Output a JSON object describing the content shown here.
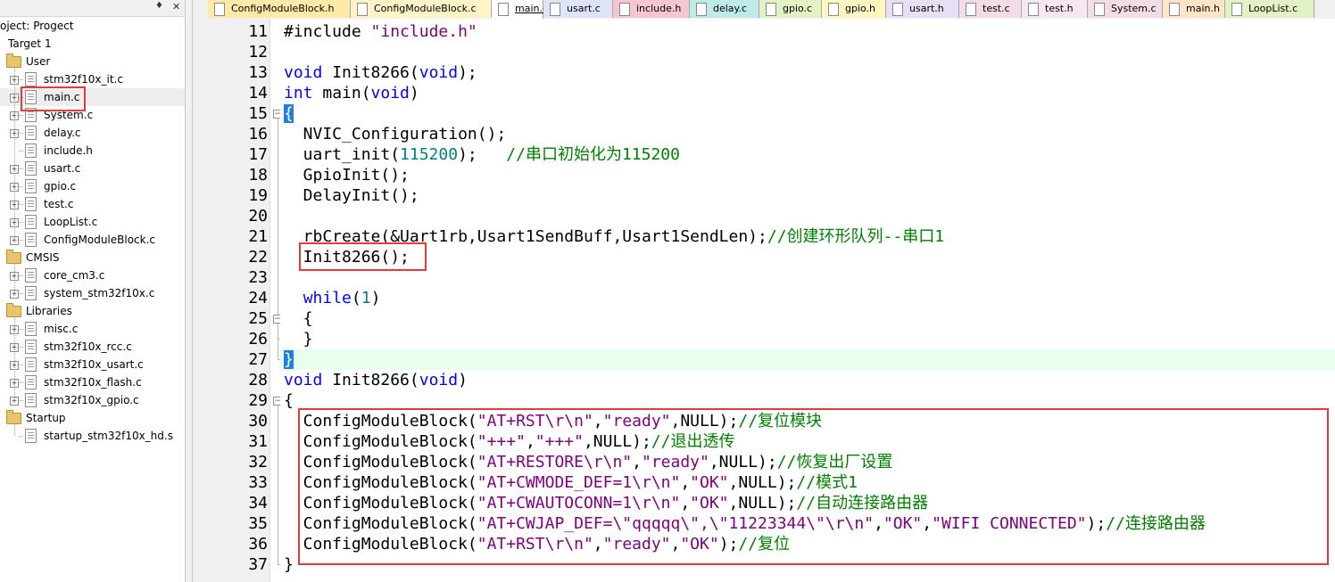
{
  "project_title": "oject: Progect",
  "tree": {
    "target": "Target 1",
    "groups": [
      {
        "name": "User",
        "files": [
          "stm32f10x_it.c",
          "main.c",
          "System.c",
          "delay.c",
          "include.h",
          "usart.c",
          "gpio.c",
          "test.c",
          "LoopList.c",
          "ConfigModuleBlock.c"
        ]
      },
      {
        "name": "CMSIS",
        "files": [
          "core_cm3.c",
          "system_stm32f10x.c"
        ]
      },
      {
        "name": "Libraries",
        "files": [
          "misc.c",
          "stm32f10x_rcc.c",
          "stm32f10x_usart.c",
          "stm32f10x_flash.c",
          "stm32f10x_gpio.c"
        ]
      },
      {
        "name": "Startup",
        "files": [
          "startup_stm32f10x_hd.s"
        ]
      }
    ]
  },
  "tabs": [
    {
      "label": "ConfigModuleBlock.h",
      "color": "#ffe9a8"
    },
    {
      "label": "ConfigModuleBlock.c",
      "color": "#fff3c8"
    },
    {
      "label": "main.c",
      "color": "#ffffff",
      "active": true
    },
    {
      "label": "usart.c",
      "color": "#dde4f5"
    },
    {
      "label": "include.h",
      "color": "#f5c6cf"
    },
    {
      "label": "delay.c",
      "color": "#bfeaea"
    },
    {
      "label": "gpio.c",
      "color": "#e3f2c4"
    },
    {
      "label": "gpio.h",
      "color": "#fff6c0"
    },
    {
      "label": "usart.h",
      "color": "#e6dff5"
    },
    {
      "label": "test.c",
      "color": "#f2dde6"
    },
    {
      "label": "test.h",
      "color": "#f5e6f0"
    },
    {
      "label": "System.c",
      "color": "#f2dde6"
    },
    {
      "label": "main.h",
      "color": "#ffe4c8"
    },
    {
      "label": "LoopList.c",
      "color": "#e3f2c4"
    }
  ],
  "code": {
    "line_numbers": [
      "11",
      "12",
      "13",
      "14",
      "15",
      "16",
      "17",
      "18",
      "19",
      "20",
      "21",
      "22",
      "23",
      "24",
      "25",
      "26",
      "27",
      "28",
      "29",
      "30",
      "31",
      "32",
      "33",
      "34",
      "35",
      "36",
      "37"
    ],
    "lines": [
      "#include \"include.h\"",
      "",
      "void Init8266(void);",
      "int main(void)",
      "{",
      "  NVIC_Configuration();",
      "  uart_init(115200);   //串口初始化为115200",
      "  GpioInit();",
      "  DelayInit();",
      "",
      "  rbCreate(&Uart1rb,Usart1SendBuff,Usart1SendLen);//创建环形队列--串口1",
      "  Init8266();",
      "",
      "  while(1)",
      "  {",
      "  }",
      "}",
      "void Init8266(void)",
      "{",
      "  ConfigModuleBlock(\"AT+RST\\r\\n\",\"ready\",NULL);//复位模块",
      "  ConfigModuleBlock(\"+++\",\"+++\",NULL);//退出透传",
      "  ConfigModuleBlock(\"AT+RESTORE\\r\\n\",\"ready\",NULL);//恢复出厂设置",
      "  ConfigModuleBlock(\"AT+CWMODE_DEF=1\\r\\n\",\"OK\",NULL);//模式1",
      "  ConfigModuleBlock(\"AT+CWAUTOCONN=1\\r\\n\",\"OK\",NULL);//自动连接路由器",
      "  ConfigModuleBlock(\"AT+CWJAP_DEF=\\\"qqqqq\\\",\\\"11223344\\\"\\r\\n\",\"OK\",\"WIFI CONNECTED\");//连接路由器",
      "  ConfigModuleBlock(\"AT+RST\\r\\n\",\"ready\",\"OK\");//复位",
      "}"
    ]
  },
  "colors": {
    "keyword": "#0000ff",
    "string": "#800080",
    "number": "#008080",
    "comment": "#008000",
    "annotation_box": "#e53a3a",
    "current_line": "#e8fff0"
  }
}
